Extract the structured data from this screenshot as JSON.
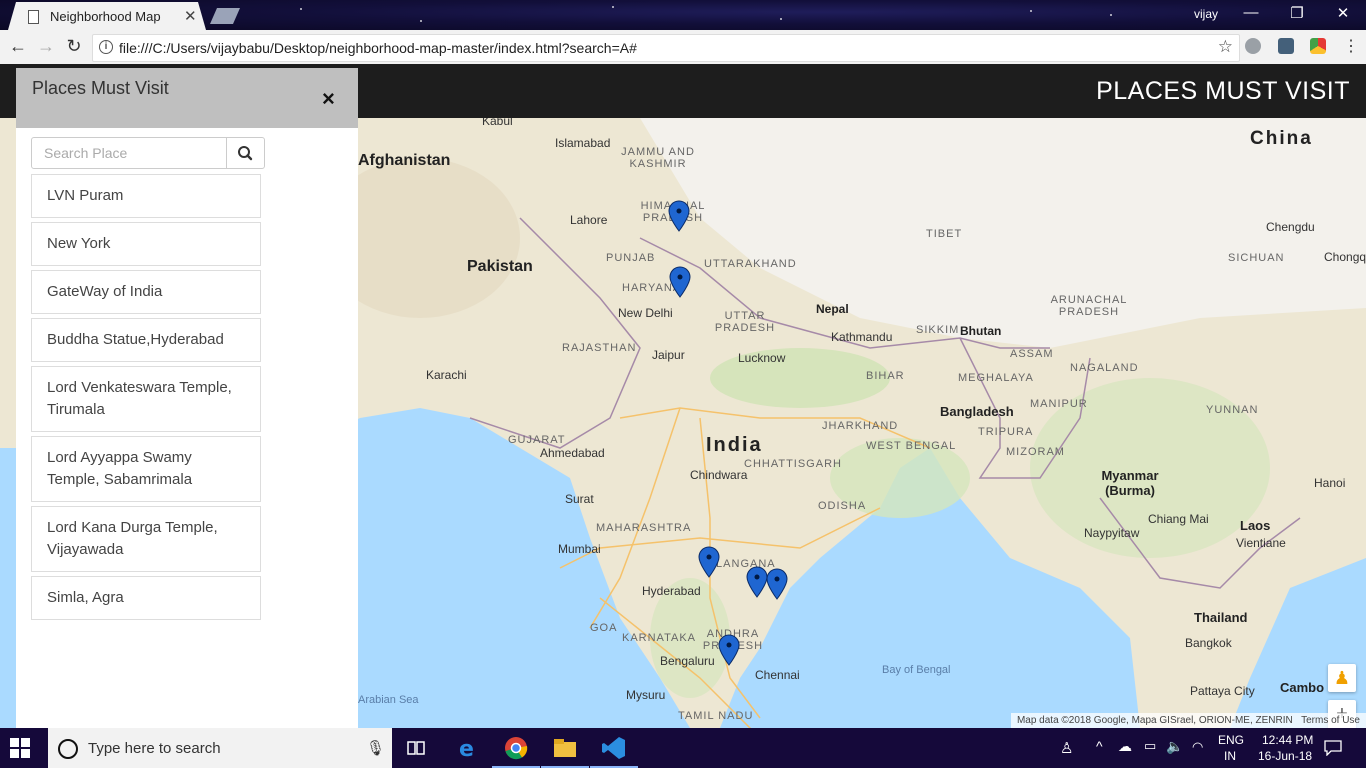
{
  "browser": {
    "tab_title": "Neighborhood Map",
    "tab_close": "✕",
    "user": "vijay",
    "url": "file:///C:/Users/vijaybabu/Desktop/neighborhood-map-master/index.html?search=A#",
    "window_controls": {
      "minimize": "—",
      "restore": "❐",
      "close": "✕"
    }
  },
  "header": {
    "title": "PLACES MUST VISIT"
  },
  "sidebar": {
    "title": "Places Must Visit",
    "close_label": "×",
    "search_placeholder": "Search Place",
    "search_icon": "search-icon",
    "places": [
      "LVN Puram",
      "New York",
      "GateWay of India",
      "Buddha Statue,Hyderabad",
      "Lord Venkateswara Temple, Tirumala",
      "Lord Ayyappa Swamy Temple, Sabamrimala",
      "Lord Kana Durga Temple, Vijayawada",
      "Simla, Agra"
    ]
  },
  "map": {
    "attribution": "Map data ©2018 Google, Mapa GISrael, ORION-ME, ZENRIN",
    "terms": "Terms of Use",
    "zoom_in": "+",
    "zoom_out": "−",
    "countries": [
      "Afghanistan",
      "Pakistan",
      "India",
      "China",
      "Nepal",
      "Bhutan",
      "Bangladesh",
      "Myanmar (Burma)",
      "Laos",
      "Thailand",
      "Cambo"
    ],
    "regions": [
      "JAMMU AND KASHMIR",
      "HIMACHAL PRADESH",
      "PUNJAB",
      "UTTARAKHAND",
      "HARYANA",
      "UTTAR PRADESH",
      "RAJASTHAN",
      "BIHAR",
      "GUJARAT",
      "JHARKHAND",
      "WEST BENGAL",
      "CHHATTISGARH",
      "ODISHA",
      "MAHARASHTRA",
      "TELANGANA",
      "ANDHRA PRADESH",
      "KARNATAKA",
      "TAMIL NADU",
      "TIBET",
      "SICHUAN",
      "YUNNAN",
      "SIKKIM",
      "ASSAM",
      "NAGALAND",
      "MANIPUR",
      "MIZORAM",
      "TRIPURA",
      "MEGHALAYA",
      "ARUNACHAL PRADESH",
      "GOA"
    ],
    "cities": [
      "Kabul",
      "Islamabad",
      "Lahore",
      "New Delhi",
      "Jaipur",
      "Lucknow",
      "Kathmandu",
      "Karachi",
      "Ahmedabad",
      "Surat",
      "Mumbai",
      "Hyderabad",
      "Bengaluru",
      "Chennai",
      "Mysuru",
      "Chindwara",
      "Chengdu",
      "Chongq",
      "Naypyitaw",
      "Chiang Mai",
      "Vientiane",
      "Hanoi",
      "Bangkok",
      "Pattaya City"
    ],
    "waters": [
      "Arabian Sea",
      "Bay of Bengal"
    ]
  },
  "taskbar": {
    "search_text": "Type here to search",
    "lang": "ENG",
    "region": "IN",
    "time": "12:44 PM",
    "date": "16-Jun-18"
  }
}
